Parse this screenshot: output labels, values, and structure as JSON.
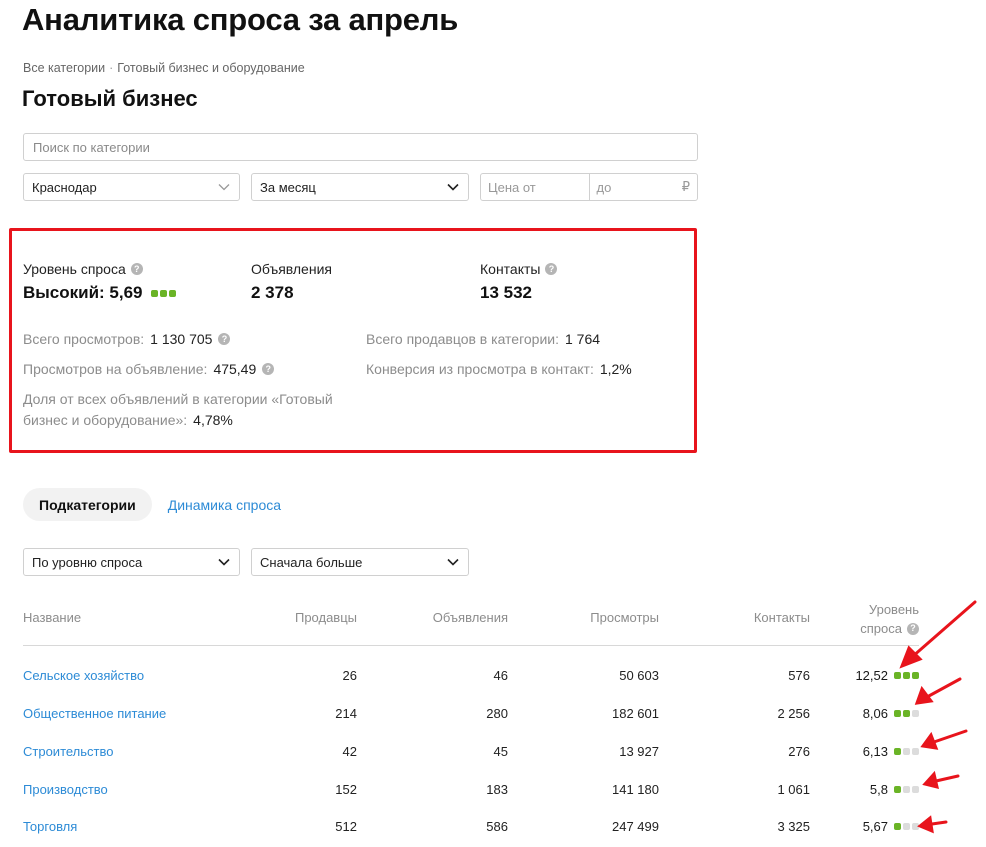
{
  "header": {
    "page_title": "Аналитика спроса за апрель",
    "breadcrumb": [
      "Все категории",
      "Готовый бизнес и оборудование"
    ],
    "breadcrumb_sep": "·",
    "section_title": "Готовый бизнес"
  },
  "filters": {
    "search_placeholder": "Поиск по категории",
    "region": "Краснодар",
    "period": "За месяц",
    "price_from_placeholder": "Цена от",
    "price_to_placeholder": "до",
    "currency": "₽"
  },
  "summary": {
    "demand_label": "Уровень спроса",
    "demand_value": "Высокий: 5,69",
    "demand_level": 3,
    "ads_label": "Объявления",
    "ads_value": "2 378",
    "contacts_label": "Контакты",
    "contacts_value": "13 532",
    "total_views_label": "Всего просмотров:",
    "total_views_value": "1 130 705",
    "views_per_ad_label": "Просмотров на объявление:",
    "views_per_ad_value": "475,49",
    "share_label": "Доля от всех объявлений в категории «Готовый бизнес и оборудование»:",
    "share_value": "4,78%",
    "sellers_label": "Всего продавцов в категории:",
    "sellers_value": "1 764",
    "conversion_label": "Конверсия из просмотра в контакт:",
    "conversion_value": "1,2%"
  },
  "tabs": {
    "active": "Подкатегории",
    "link": "Динамика спроса"
  },
  "sort": {
    "by": "По уровню спроса",
    "order": "Сначала больше"
  },
  "table": {
    "columns": {
      "name": "Название",
      "sellers": "Продавцы",
      "ads": "Объявления",
      "views": "Просмотры",
      "contacts": "Контакты",
      "level_line1": "Уровень",
      "level_line2": "спроса"
    },
    "rows": [
      {
        "name": "Сельское хозяйство",
        "sellers": "26",
        "ads": "46",
        "views": "50 603",
        "contacts": "576",
        "level": "12,52",
        "dots": 3
      },
      {
        "name": "Общественное питание",
        "sellers": "214",
        "ads": "280",
        "views": "182 601",
        "contacts": "2 256",
        "level": "8,06",
        "dots": 2
      },
      {
        "name": "Строительство",
        "sellers": "42",
        "ads": "45",
        "views": "13 927",
        "contacts": "276",
        "level": "6,13",
        "dots": 1
      },
      {
        "name": "Производство",
        "sellers": "152",
        "ads": "183",
        "views": "141 180",
        "contacts": "1 061",
        "level": "5,8",
        "dots": 1
      },
      {
        "name": "Торговля",
        "sellers": "512",
        "ads": "586",
        "views": "247 499",
        "contacts": "3 325",
        "level": "5,67",
        "dots": 1
      }
    ]
  },
  "colors": {
    "accent_link": "#2d8bd6",
    "level_on": "#6ab426",
    "level_off": "#dcdcdc",
    "highlight": "#e8141c"
  }
}
